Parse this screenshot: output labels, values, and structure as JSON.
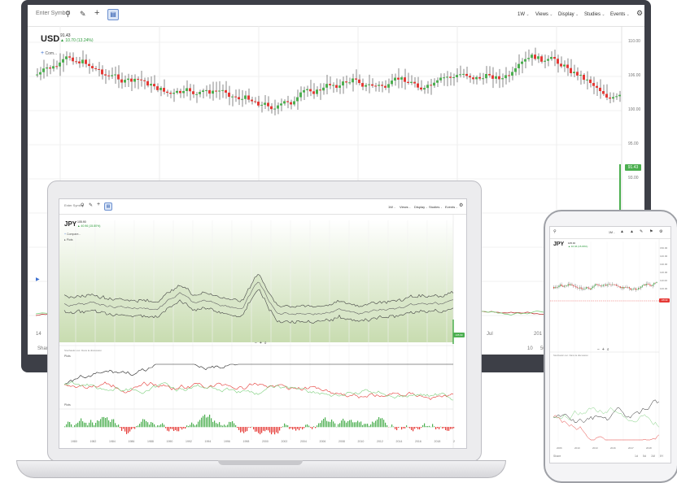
{
  "monitor": {
    "search": {
      "placeholder": "Enter Symbol"
    },
    "menus": [
      "1W",
      "Views",
      "Display",
      "Studies",
      "Events"
    ],
    "symbol": "USD",
    "price": "91.43",
    "change": "▲ 10.70 (13.24%)",
    "overlay_label": "Com...",
    "y_ticks": [
      "110.00",
      "106.00",
      "100.00",
      "95.00",
      "93.00"
    ],
    "last_price_tag": "91.43",
    "x_labels": [
      "14",
      "Jul",
      "201"
    ],
    "bottom_left": "Share",
    "bottom_right": [
      "10",
      "50"
    ]
  },
  "laptop": {
    "search": {
      "placeholder": "Enter Symbol"
    },
    "menus": [
      "1W",
      "Views",
      "Display",
      "Studies",
      "Events"
    ],
    "symbol": "JPY",
    "price": "105.90",
    "change": "▲ 40.96 (15.80%)",
    "overlays": [
      "Compare...",
      "Plots"
    ],
    "panel_labels": [
      "Plots",
      "Plots"
    ],
    "panel1_caption": "Stochastic osc. Dans la discussion",
    "zoom_controls": [
      "−",
      "+",
      "⌕"
    ],
    "x_labels": [
      "1980",
      "1982",
      "1984",
      "1986",
      "1988",
      "1990",
      "1992",
      "1994",
      "1996",
      "1998",
      "2000",
      "2002",
      "2004",
      "2006",
      "2008",
      "2010",
      "2012",
      "2014",
      "2016",
      "2018",
      "2"
    ],
    "last_price_tag": "105.90"
  },
  "phone": {
    "menus": [
      "1M"
    ],
    "symbol": "JPY",
    "price": "105.90",
    "change": "▲ 40.96 (15.80%)",
    "y_ticks": [
      "150.00",
      "140.00",
      "130.00",
      "120.00",
      "110.00",
      "100.00"
    ],
    "last_price_tag": "105.90",
    "panel_caption": "Stochastic osc. Dans la discussion",
    "zoom_controls": [
      "−",
      "+",
      "⌕"
    ],
    "x_labels": [
      "2006",
      "2010",
      "2013",
      "2016",
      "2017",
      "2018"
    ],
    "bottom_left": "Share",
    "bottom_right": [
      "1d",
      "5d",
      "1M",
      "5Y"
    ]
  },
  "colors": {
    "up": "#4caf50",
    "down": "#e53935",
    "band_fill": "#c8dcb0",
    "accent_blue": "#3b6fd0",
    "bezel": "#3d3f47"
  },
  "icons": [
    "search-icon",
    "pencil-icon",
    "crosshair-icon",
    "comment-icon",
    "settings-icon"
  ]
}
